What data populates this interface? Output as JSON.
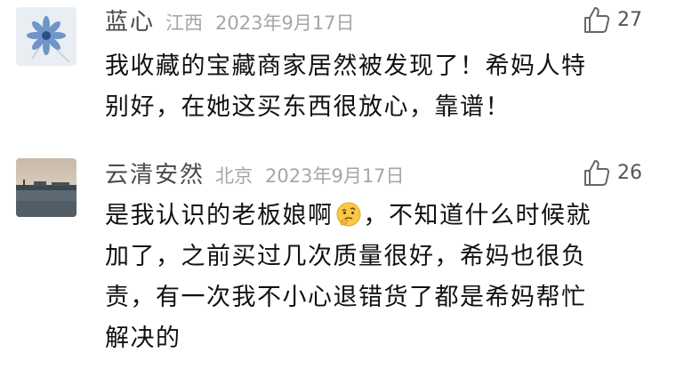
{
  "comments": [
    {
      "user": "蓝心",
      "location": "江西",
      "date": "2023年9月17日",
      "likes": "27",
      "avatar_icon": "blue-flower-avatar",
      "lines": [
        "我收藏的宝藏商家居然被发现了！希妈人特",
        "别好，在她这买东西很放心，靠谱！"
      ]
    },
    {
      "user": "云清安然",
      "location": "北京",
      "date": "2023年9月17日",
      "likes": "26",
      "avatar_icon": "harbor-photo-avatar",
      "lines": [
        "是我认识的老板娘啊",
        "，不知道什么时候就",
        "加了，之前买过几次质量很好，希妈也很负",
        "责，有一次我不小心退错货了都是希妈帮忙",
        "解决的"
      ],
      "emoji_icon": "thinking-face-emoji"
    }
  ],
  "colors": {
    "name": "#4a4a4a",
    "meta": "#a6a6a6",
    "body": "#111111"
  }
}
